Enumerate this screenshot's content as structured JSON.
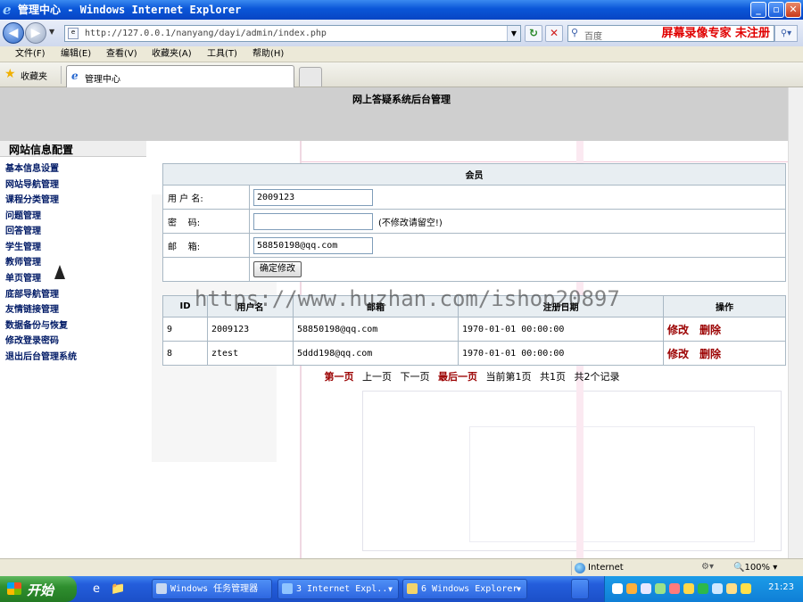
{
  "window": {
    "title": "管理中心 - Windows Internet Explorer",
    "minimize": "_",
    "maximize": "▫",
    "close": "✕"
  },
  "navbar": {
    "url": "http://127.0.0.1/nanyang/dayi/admin/index.php",
    "search_placeholder": "百度",
    "watermark_text": "屏幕录像专家 未注册"
  },
  "menu": [
    "文件(F)",
    "编辑(E)",
    "查看(V)",
    "收藏夹(A)",
    "工具(T)",
    "帮助(H)"
  ],
  "favorites": {
    "label": "收藏夹",
    "tab_label": "管理中心"
  },
  "page": {
    "header_title": "网上答疑系统后台管理",
    "sidebar_title": "网站信息配置",
    "sidebar_items": [
      "基本信息设置",
      "网站导航管理",
      "课程分类管理",
      "问题管理",
      "回答管理",
      "学生管理",
      "教师管理",
      "单页管理",
      "底部导航管理",
      "友情链接管理",
      "数据备份与恢复",
      "修改登录密码",
      "退出后台管理系统"
    ]
  },
  "form": {
    "title": "会员",
    "username_label": "用 户 名:",
    "username_value": "2009123",
    "password_label": "密    码:",
    "password_value": "",
    "password_hint": "(不修改请留空!)",
    "email_label": "邮    箱:",
    "email_value": "58850198@qq.com",
    "submit_label": "确定修改"
  },
  "table": {
    "headers": [
      "ID",
      "用户名",
      "邮箱",
      "注册日期",
      "操作"
    ],
    "rows": [
      {
        "id": "9",
        "username": "2009123",
        "email": "58850198@qq.com",
        "date": "1970-01-01 00:00:00",
        "edit": "修改",
        "delete": "删除"
      },
      {
        "id": "8",
        "username": "ztest",
        "email": "5ddd198@qq.com",
        "date": "1970-01-01 00:00:00",
        "edit": "修改",
        "delete": "删除"
      }
    ]
  },
  "pager": {
    "first": "第一页",
    "prev": "上一页",
    "next": "下一页",
    "last": "最后一页",
    "current": "当前第1页",
    "total_pages": "共1页",
    "total_records": "共2个记录"
  },
  "overlay_watermark": "https://www.huzhan.com/ishop20897",
  "statusbar": {
    "zone": "Internet",
    "zoom": "100%"
  },
  "taskbar": {
    "start_label": "开始",
    "tasks": [
      "Windows 任务管理器",
      "3 Internet Expl...",
      "6 Windows Explorer"
    ],
    "clock": "21:23"
  },
  "colors": {
    "accent_red": "#9b0000",
    "titlebar_blue": "#0a56d8",
    "table_border": "#a9b8c4"
  }
}
